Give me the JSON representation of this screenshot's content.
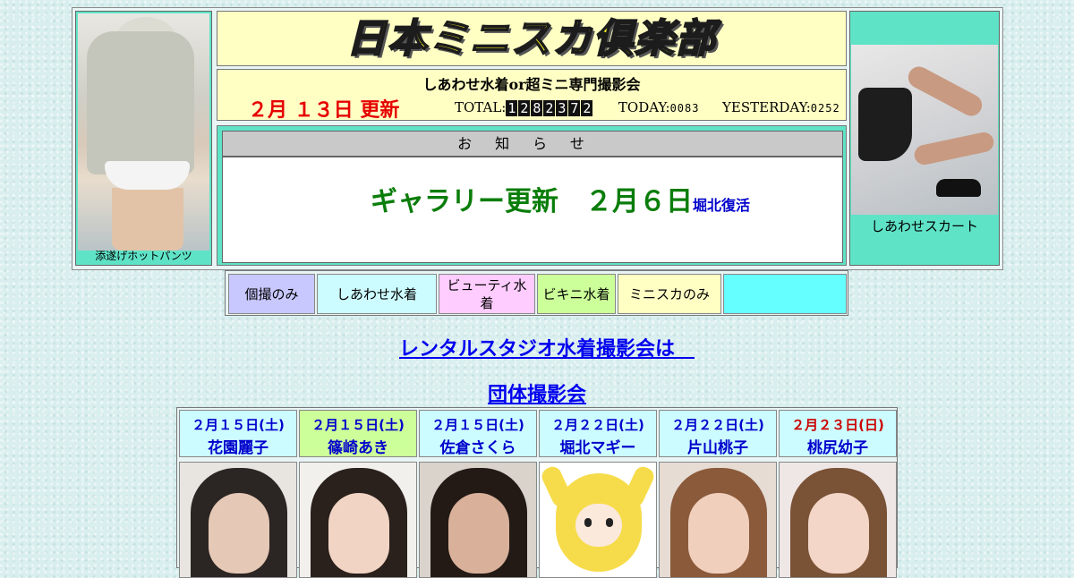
{
  "site_title": "日本ミニスカ倶楽部",
  "subtitle": "しあわせ水着or超ミニ専門撮影会",
  "update_date": "２月 １３日 更新",
  "counters": {
    "total_label": "TOTAL:",
    "total_digits": [
      "1",
      "2",
      "8",
      "2",
      "3",
      "7",
      "2"
    ],
    "today_label": "TODAY:",
    "today_value": "0083",
    "yesterday_label": "YESTERDAY:",
    "yesterday_value": "0252"
  },
  "left_photo": {
    "caption": "添遂げホットパンツ"
  },
  "right_photo": {
    "caption": "しあわせスカート"
  },
  "notice": {
    "header": "お知らせ",
    "message": "ギャラリー更新　２月６日",
    "tag": "堀北復活"
  },
  "nav": [
    {
      "label": "個撮のみ",
      "color": "#c8c8ff"
    },
    {
      "label": "しあわせ水着",
      "color": "#ccfcff"
    },
    {
      "label": "ビューティ水着",
      "color": "#ffccff"
    },
    {
      "label": "ビキニ水着",
      "color": "#ccff99"
    },
    {
      "label": "ミニスカのみ",
      "color": "#ffffc4"
    },
    {
      "label": "",
      "color": "#66ffff"
    }
  ],
  "links": {
    "rental": "レンタルスタジオ水着撮影会は　",
    "group": "団体撮影会"
  },
  "schedule": [
    {
      "date": "２月１５日(土)",
      "name": "花園麗子",
      "bg": "#ccfcff",
      "date_color": "#0000cc"
    },
    {
      "date": "２月１５日(土)",
      "name": "篠崎あき",
      "bg": "#ccff99",
      "date_color": "#0000cc"
    },
    {
      "date": "２月１５日(土)",
      "name": "佐倉さくら",
      "bg": "#ccfcff",
      "date_color": "#0000cc"
    },
    {
      "date": "２月２２日(土)",
      "name": "堀北マギー",
      "bg": "#ccfcff",
      "date_color": "#0000cc"
    },
    {
      "date": "２月２２日(土)",
      "name": "片山桃子",
      "bg": "#ccfcff",
      "date_color": "#0000cc"
    },
    {
      "date": "２月２３日(日)",
      "name": "桃尻幼子",
      "bg": "#ccfcff",
      "date_color": "#cc0000"
    }
  ],
  "colors": {
    "teal": "#5fe3c7",
    "cream": "#ffffc4",
    "red": "#e60000",
    "green": "#0a7d0a",
    "link": "#0000ee"
  }
}
